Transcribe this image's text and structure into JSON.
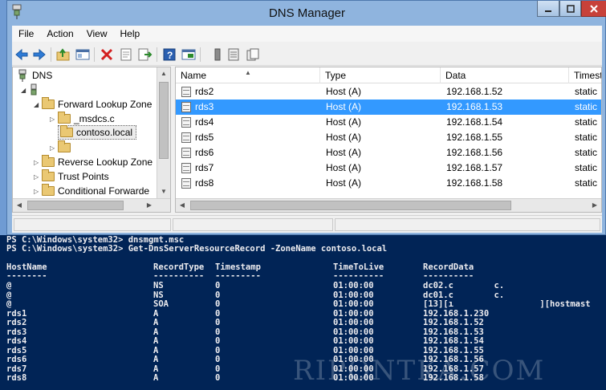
{
  "window": {
    "title": "DNS Manager",
    "controls": [
      "minimize-icon",
      "maximize-icon",
      "close-icon"
    ]
  },
  "menu": [
    "File",
    "Action",
    "View",
    "Help"
  ],
  "toolbar": [
    "back-icon",
    "forward-icon",
    "up-folder-icon",
    "show-tree-icon",
    "delete-icon",
    "properties-icon",
    "export-icon",
    "help-icon",
    "mmc-icon",
    "server-icon",
    "list-icon",
    "copy-icon"
  ],
  "tree": {
    "root": "DNS",
    "items": [
      {
        "label": "Forward Lookup Zone",
        "expanded": true
      },
      {
        "label": "_msdcs.c",
        "expanded": false
      },
      {
        "label": "contoso.local",
        "selected": true
      },
      {
        "label": "",
        "expanded": false
      },
      {
        "label": "Reverse Lookup Zone",
        "expanded": false
      },
      {
        "label": "Trust Points",
        "expanded": false
      },
      {
        "label": "Conditional Forwarde",
        "expanded": false
      }
    ]
  },
  "list": {
    "columns": [
      "Name",
      "Type",
      "Data",
      "Timest"
    ],
    "rows": [
      {
        "name": "rds2",
        "type": "Host (A)",
        "data": "192.168.1.52",
        "ts": "static"
      },
      {
        "name": "rds3",
        "type": "Host (A)",
        "data": "192.168.1.53",
        "ts": "static",
        "selected": true
      },
      {
        "name": "rds4",
        "type": "Host (A)",
        "data": "192.168.1.54",
        "ts": "static"
      },
      {
        "name": "rds5",
        "type": "Host (A)",
        "data": "192.168.1.55",
        "ts": "static"
      },
      {
        "name": "rds6",
        "type": "Host (A)",
        "data": "192.168.1.56",
        "ts": "static"
      },
      {
        "name": "rds7",
        "type": "Host (A)",
        "data": "192.168.1.57",
        "ts": "static"
      },
      {
        "name": "rds8",
        "type": "Host (A)",
        "data": "192.168.1.58",
        "ts": "static"
      }
    ]
  },
  "console": {
    "lines": [
      "PS C:\\Windows\\system32> dnsmgmt.msc",
      "PS C:\\Windows\\system32> Get-DnsServerResourceRecord -ZoneName contoso.local"
    ],
    "headers": [
      "HostName",
      "RecordType",
      "Timestamp",
      "TimeToLive",
      "RecordData"
    ],
    "rules": [
      "--------",
      "----------",
      "---------",
      "----------",
      "----------"
    ],
    "rows": [
      [
        "@",
        "NS",
        "0",
        "01:00:00",
        "dc02.c        c."
      ],
      [
        "@",
        "NS",
        "0",
        "01:00:00",
        "dc01.c        c."
      ],
      [
        "@",
        "SOA",
        "0",
        "01:00:00",
        "[13][ı                 ][hostmast"
      ],
      [
        "rds1",
        "A",
        "0",
        "01:00:00",
        "192.168.1.230"
      ],
      [
        "rds2",
        "A",
        "0",
        "01:00:00",
        "192.168.1.52"
      ],
      [
        "rds3",
        "A",
        "0",
        "01:00:00",
        "192.168.1.53"
      ],
      [
        "rds4",
        "A",
        "0",
        "01:00:00",
        "192.168.1.54"
      ],
      [
        "rds5",
        "A",
        "0",
        "01:00:00",
        "192.168.1.55"
      ],
      [
        "rds6",
        "A",
        "0",
        "01:00:00",
        "192.168.1.56"
      ],
      [
        "rds7",
        "A",
        "0",
        "01:00:00",
        "192.168.1.57"
      ],
      [
        "rds8",
        "A",
        "0",
        "01:00:00",
        "192.168.1.58"
      ]
    ]
  },
  "watermark": "RIPONTKA.COM"
}
